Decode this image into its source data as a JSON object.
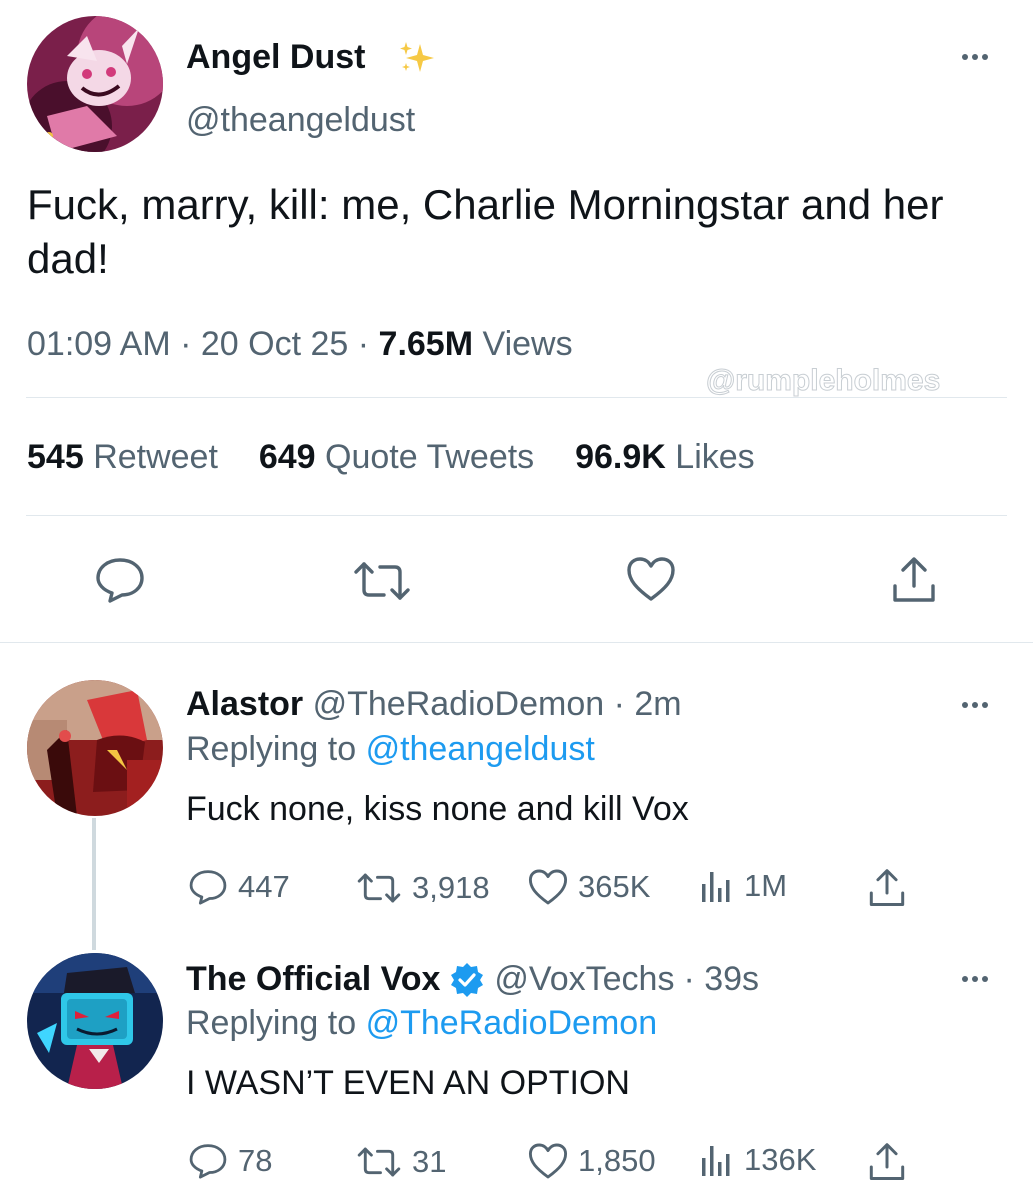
{
  "tweet": {
    "author_name": "Angel Dust",
    "author_handle": "@theangeldust",
    "text": "Fuck, marry, kill: me, Charlie Morningstar and her dad!",
    "time": "01:09 AM",
    "date": "20 Oct 25",
    "separator": "·",
    "views_count": "7.65M",
    "views_label": "Views",
    "watermark": "@rumpleholmes",
    "retweet_count": "545",
    "retweet_label": "Retweet",
    "quote_count": "649",
    "quote_label": "Quote Tweets",
    "likes_count": "96.9K",
    "likes_label": "Likes"
  },
  "replies": [
    {
      "name": "Alastor",
      "handle": "@TheRadioDemon",
      "time": "· 2m",
      "replying_prefix": "Replying to",
      "replying_to": "@theangeldust",
      "text": "Fuck none, kiss none and kill Vox",
      "replies": "447",
      "retweets": "3,918",
      "likes": "365K",
      "views": "1M"
    },
    {
      "name": "The Official Vox",
      "handle": "@VoxTechs",
      "time": "· 39s",
      "replying_prefix": "Replying to",
      "replying_to": "@TheRadioDemon",
      "text": "I WASN’T EVEN AN OPTION",
      "replies": "78",
      "retweets": "31",
      "likes": "1,850",
      "views": "136K"
    }
  ],
  "colors": {
    "text": "#0f1419",
    "secondary": "#536471",
    "link": "#1d9bf0",
    "divider": "#e1e8ed"
  }
}
